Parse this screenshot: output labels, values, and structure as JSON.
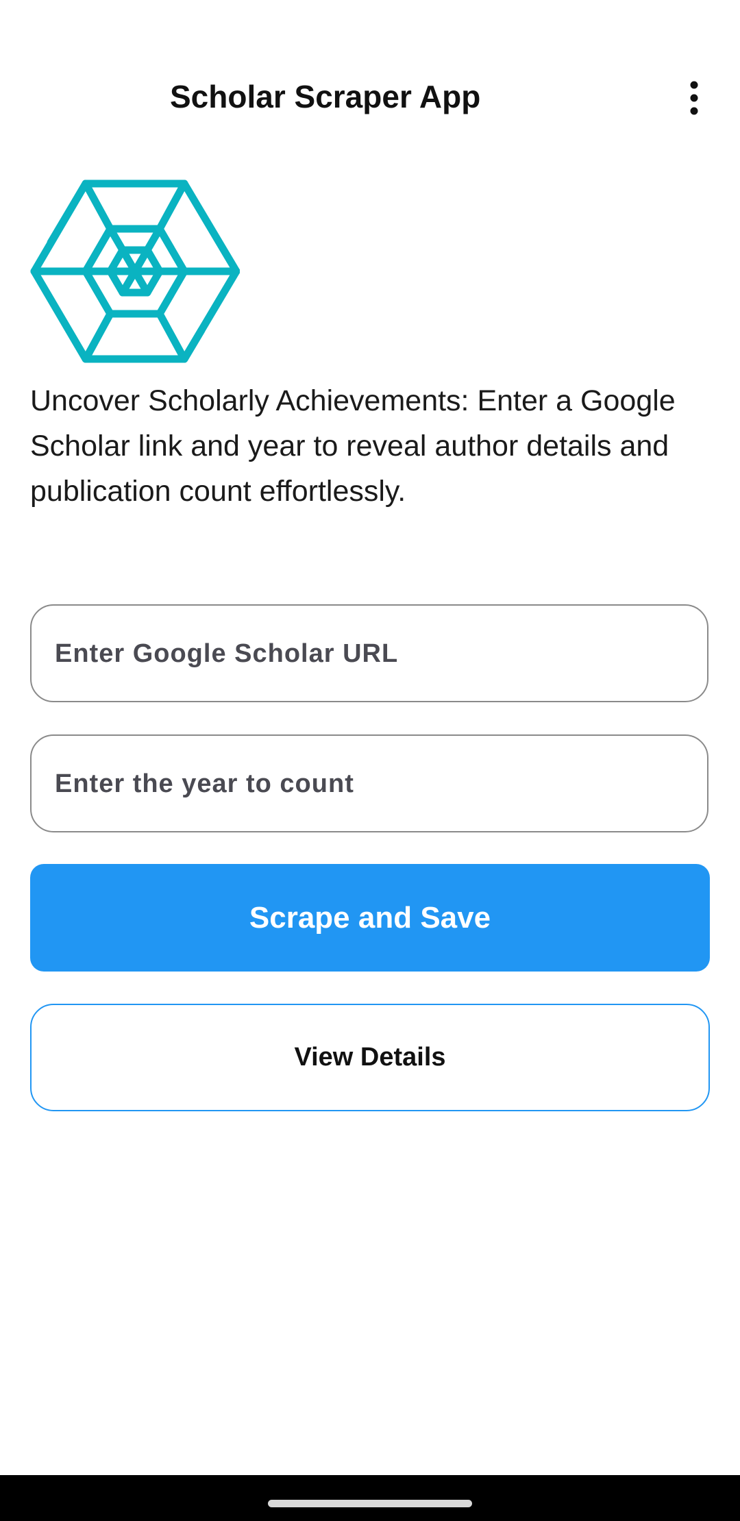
{
  "app_bar": {
    "title": "Scholar Scraper App",
    "menu_icon": "more-vert-icon"
  },
  "logo": {
    "icon": "hexagon-web-logo",
    "color": "#0ab3c1"
  },
  "description": "Uncover Scholarly Achievements: Enter a Google Scholar link and year to reveal author details and publication count effortlessly.",
  "form": {
    "url_field": {
      "value": "",
      "placeholder": "Enter Google Scholar URL"
    },
    "year_field": {
      "value": "",
      "placeholder": "Enter the year to count"
    }
  },
  "buttons": {
    "scrape_label": "Scrape and Save",
    "view_label": "View Details"
  },
  "colors": {
    "accent": "#2196f3",
    "logo": "#0ab3c1",
    "nav_bar": "#000000"
  },
  "system_nav": {
    "handle_icon": "home-gesture-pill"
  }
}
